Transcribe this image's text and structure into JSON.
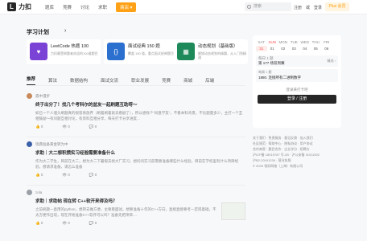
{
  "header": {
    "logo_mark": "L",
    "logo_text": "力扣",
    "nav": [
      "题库",
      "竞赛",
      "讨论",
      "求职",
      "商店 ▾"
    ],
    "search_placeholder": "搜索",
    "links": [
      "注册",
      "或",
      "登录"
    ],
    "plus_label": "Plus 会员"
  },
  "study_plan": {
    "title": "学习计划",
    "arrow": "›",
    "items": [
      {
        "name": "LeetCode 热题 100",
        "desc": "力扣最受刷题者欢迎的100道题目",
        "color": "#7b42d6",
        "icon": "heart-icon",
        "glyph": "♥"
      },
      {
        "name": "面试经典 150 题",
        "desc": "覆盖 150 道，重点面试经典题目",
        "color": "#2b6fcf",
        "icon": "code-icon",
        "glyph": "{}"
      },
      {
        "name": "动态规划（基础版）",
        "desc": "解锁动态规划的精髓，从入门到精通",
        "color": "#1e8a5a",
        "icon": "dp-icon",
        "glyph": "▦"
      }
    ]
  },
  "tabs": [
    "推荐",
    "算法",
    "数据结构",
    "面试交流",
    "职业发展",
    "竞赛",
    "商城",
    "后端"
  ],
  "posts": [
    {
      "author": "孤中漫步",
      "avatar_color": "#c88a5a",
      "title": "终于出分了！找几个考科尔的盆友一起刷题互助呀～",
      "body": "如已一个人埋头刷题真的很容易放弃（刷着刷着就去看剧了），所以想找个“同盘学友”，不看本科背景，不比题量多少，主打一个互相鼓励～有问题互相讨论，有资料互相分享，每天打卡分享进度..."
    },
    {
      "author": "瑞典准备黄金转为中",
      "avatar_color": "#3b5fa8",
      "title": "求助｜大二想积攒实习经验需要准备什么",
      "body": "作为大二学生，目前在大二，想为大二下暑假去找大厂实习，想问问实习前需要准备哪些什么经验，目前在学校里有什么项目经验，想请求准备，请怎么准备"
    },
    {
      "author": "zola",
      "avatar_color": "#9aa0a6",
      "title": "求助｜求助帖 现在转 C++软开来得及吗？",
      "body": "之前刷题一直用的python，想转去做方便，主要看面试。想要准备十年的C++方向，直接直接要考一定岗基础，不太方便作出现，现在开始准备C++软开可以吗？准备先把项目...."
    }
  ],
  "post_stats_icons": [
    "like-icon",
    "view-icon",
    "comment-icon"
  ],
  "post_stats_values": [
    "0",
    "0",
    "0"
  ],
  "calendar": {
    "weekdays": [
      "SAT",
      "SUN",
      "MON",
      "TUE",
      "WED",
      "THU",
      "FRI"
    ],
    "days": [
      "31",
      "01",
      "02",
      "03",
      "04",
      "05",
      "06"
    ],
    "daily_title": "每日 1 题",
    "daily_problem": "第 177 场双周赛",
    "daily_link": "精选 ›",
    "weekly_title": "每周 1 题",
    "weekly_problem": "1880. 连接所有二进制数字",
    "checkin_note": "登录来打卡吧",
    "login_label": "登录 / 注册"
  },
  "footer": [
    "关于我们 · 免责服务 · 意见反馈 · 加入我们",
    "社区规范 · 帮助中心 · 隐私协议 · 用户协议",
    "合作商家 · 题目合作 · 企业学分 · 招聘方",
    "沪ICP备 18019787 号-2B · 沪公安备 31011502",
    "沪B2-20191234 · 营业执照",
    "© 2025 领扣网络（上海）有限公司"
  ]
}
